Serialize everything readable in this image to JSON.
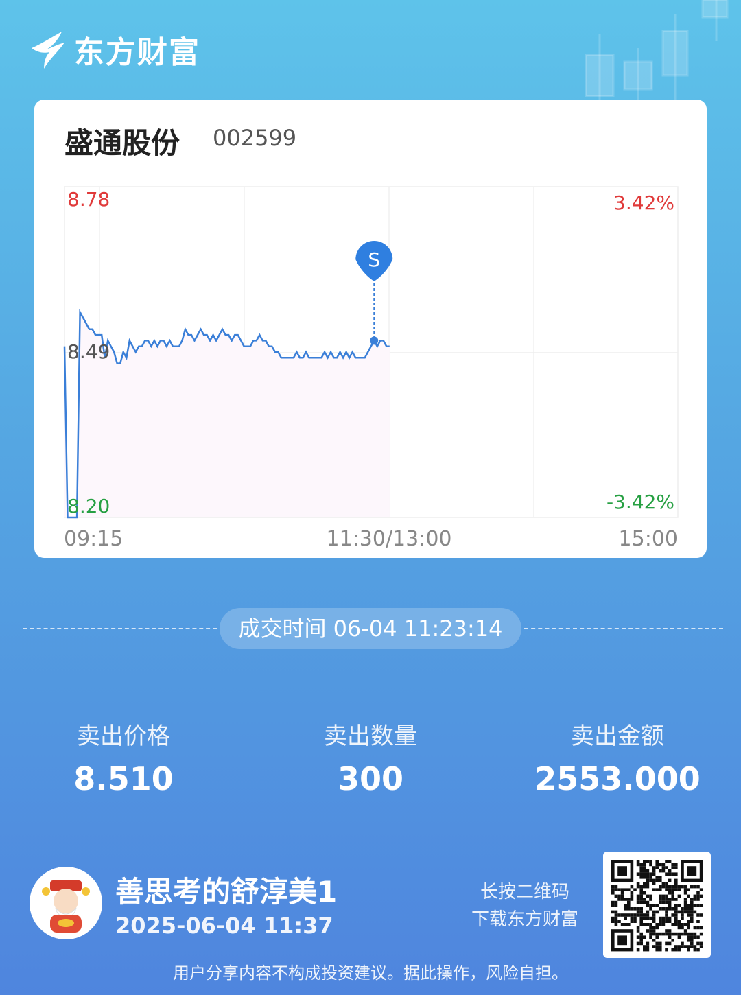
{
  "brand": {
    "name": "东方财富"
  },
  "stock": {
    "name": "盛通股份",
    "code": "002599"
  },
  "chart_data": {
    "type": "line",
    "price_high": "8.78",
    "price_mid": "8.49",
    "price_low": "8.20",
    "pct_high": "3.42%",
    "pct_low": "-3.42%",
    "x_ticks": [
      "09:15",
      "11:30/13:00",
      "15:00"
    ],
    "ylim": [
      8.2,
      8.78
    ],
    "series": [
      {
        "values": [
          8.5,
          8.2,
          8.2,
          8.2,
          8.2,
          8.56,
          8.55,
          8.54,
          8.53,
          8.53,
          8.52,
          8.52,
          8.52,
          8.48,
          8.51,
          8.5,
          8.49,
          8.47,
          8.47,
          8.49,
          8.48,
          8.51,
          8.5,
          8.49,
          8.5,
          8.5,
          8.51,
          8.51,
          8.5,
          8.51,
          8.5,
          8.51,
          8.51,
          8.5,
          8.51,
          8.5,
          8.5,
          8.5,
          8.51,
          8.53,
          8.52,
          8.52,
          8.51,
          8.52,
          8.53,
          8.52,
          8.52,
          8.51,
          8.52,
          8.51,
          8.52,
          8.53,
          8.52,
          8.52,
          8.51,
          8.52,
          8.52,
          8.51,
          8.5,
          8.5,
          8.5,
          8.51,
          8.51,
          8.52,
          8.51,
          8.51,
          8.5,
          8.5,
          8.49,
          8.49,
          8.48,
          8.48,
          8.48,
          8.48,
          8.48,
          8.49,
          8.48,
          8.48,
          8.49,
          8.48,
          8.48,
          8.48,
          8.48,
          8.48,
          8.49,
          8.48,
          8.49,
          8.48,
          8.48,
          8.49,
          8.48,
          8.49,
          8.48,
          8.49,
          8.48,
          8.48,
          8.48,
          8.48,
          8.49,
          8.5,
          8.51,
          8.5,
          8.51,
          8.51,
          8.5,
          8.5
        ],
        "x_end_fraction": 0.53
      }
    ],
    "trade_marker": {
      "label": "S",
      "price": 8.51,
      "index": 100
    }
  },
  "trade": {
    "time_label": "成交时间 06-04 11:23:14",
    "price_label": "卖出价格",
    "price": "8.510",
    "qty_label": "卖出数量",
    "qty": "300",
    "amount_label": "卖出金额",
    "amount": "2553.000"
  },
  "user": {
    "name": "善思考的舒淳美1",
    "datetime": "2025-06-04 11:37"
  },
  "qr": {
    "hint_line1": "长按二维码",
    "hint_line2": "下载东方财富"
  },
  "disclaimer": "用户分享内容不构成投资建议。据此操作，风险自担。",
  "colors": {
    "up": "#e03a3a",
    "down": "#27a043",
    "line": "#3a7fd8",
    "marker": "#2f7fe0"
  }
}
